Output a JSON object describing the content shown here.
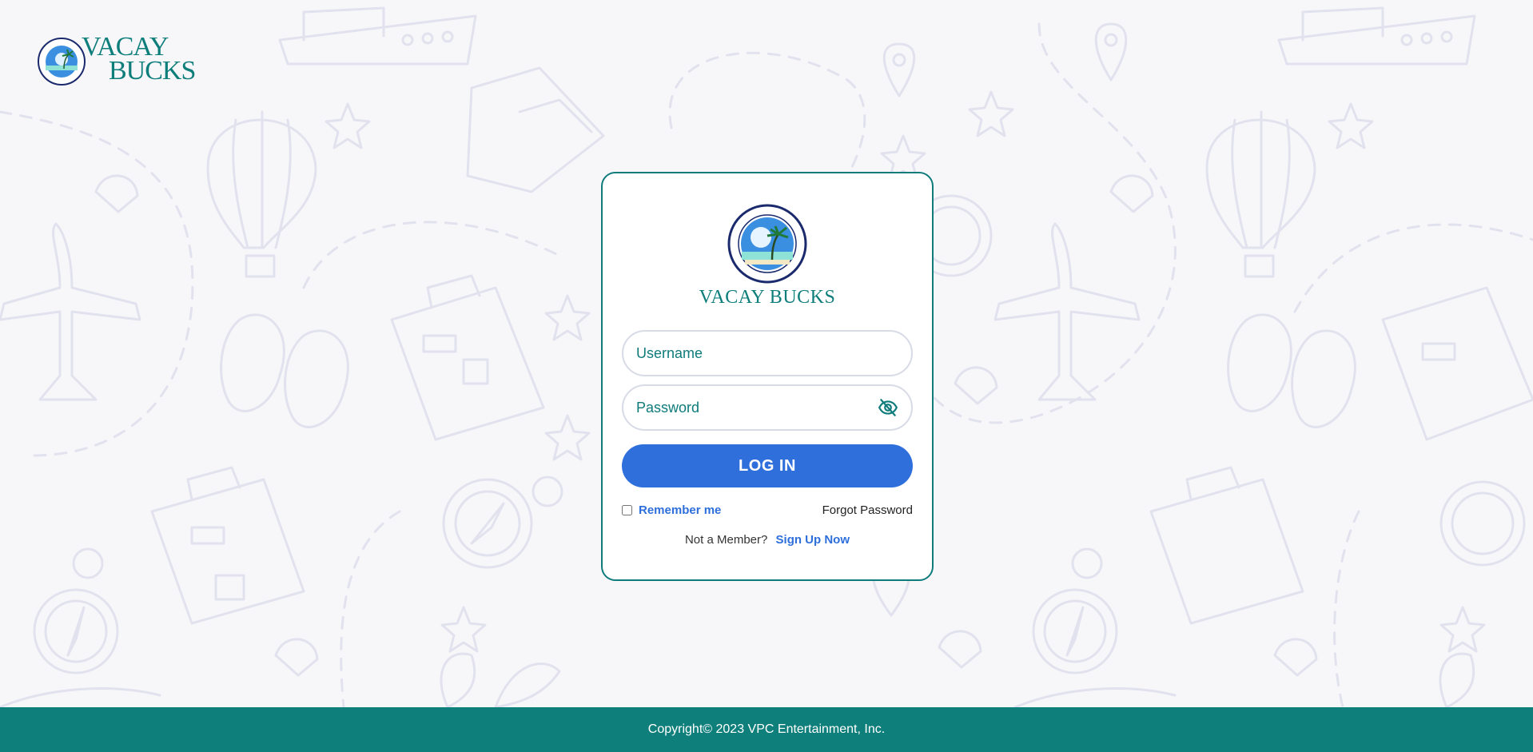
{
  "header": {
    "logo_line1": "VACAY",
    "logo_line2": "BUCKS"
  },
  "login_card": {
    "brand_name": "VACAY BUCKS",
    "username_placeholder": "Username",
    "password_placeholder": "Password",
    "password_toggle_icon": "eye-slash-icon",
    "login_label": "LOG IN",
    "remember_label": "Remember me",
    "remember_checked": false,
    "forgot_label": "Forgot Password",
    "not_member_text": "Not a Member?",
    "signup_label": "Sign Up Now"
  },
  "footer": {
    "copyright": "Copyright© 2023 VPC Entertainment, Inc."
  },
  "colors": {
    "brand_teal": "#0f7f7c",
    "button_blue": "#2e6fdb",
    "background": "#f7f7fa",
    "pattern_stroke": "#e3e3ef"
  }
}
